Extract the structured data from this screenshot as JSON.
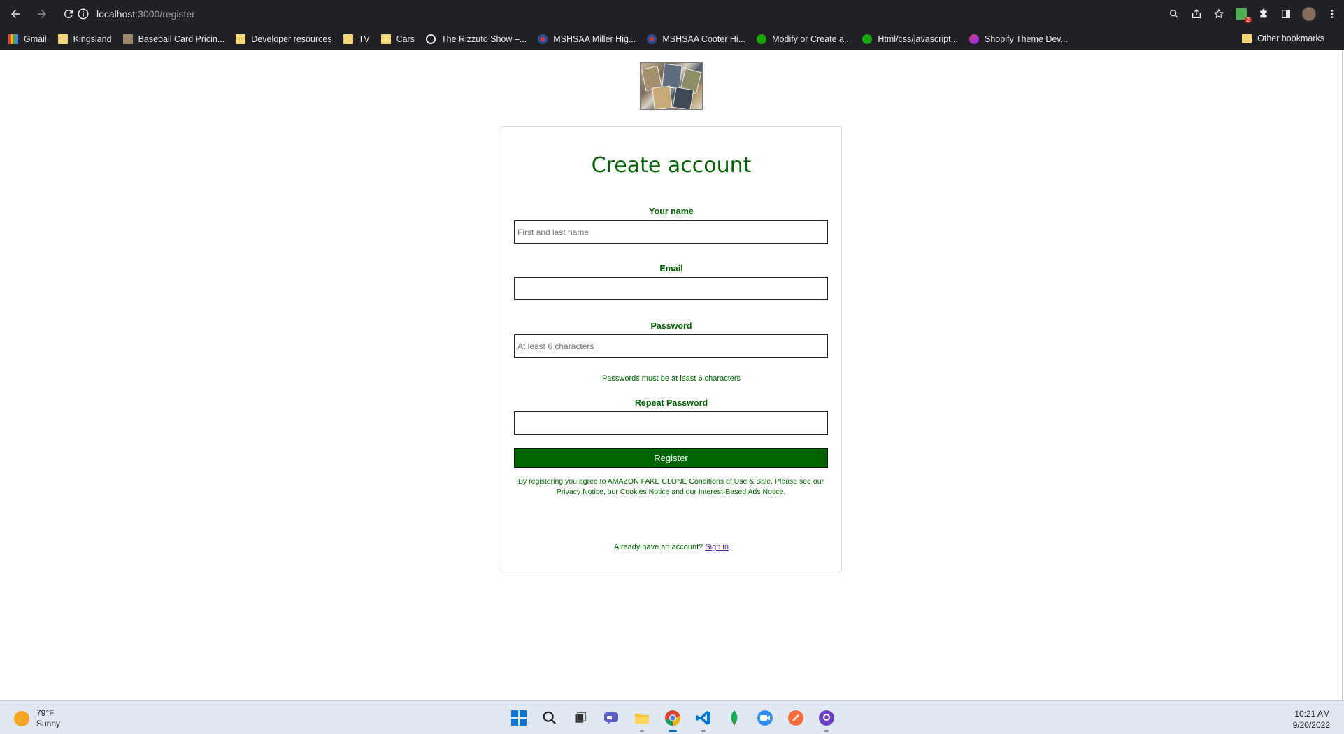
{
  "browser": {
    "url_host": "localhost",
    "url_path": ":3000/register",
    "bookmarks": [
      {
        "label": "Gmail",
        "icon": "gmail-icon"
      },
      {
        "label": "Kingsland",
        "icon": "folder-icon"
      },
      {
        "label": "Baseball Card Pricin...",
        "icon": "card-site-icon"
      },
      {
        "label": "Developer resources",
        "icon": "folder-icon"
      },
      {
        "label": "TV",
        "icon": "folder-icon"
      },
      {
        "label": "Cars",
        "icon": "folder-icon"
      },
      {
        "label": "The Rizzuto Show –...",
        "icon": "site-icon"
      },
      {
        "label": "MSHSAA Miller Hig...",
        "icon": "mshsaa-icon"
      },
      {
        "label": "MSHSAA Cooter Hi...",
        "icon": "mshsaa-icon"
      },
      {
        "label": "Modify or Create a...",
        "icon": "upwork-icon"
      },
      {
        "label": "Html/css/javascript...",
        "icon": "upwork-icon"
      },
      {
        "label": "Shopify Theme Dev...",
        "icon": "shopify-icon"
      }
    ],
    "other_bookmarks": "Other bookmarks",
    "extension_badge": "2"
  },
  "form": {
    "title": "Create account",
    "name_label": "Your name",
    "name_placeholder": "First and last name",
    "email_label": "Email",
    "email_value": "",
    "password_label": "Password",
    "password_placeholder": "At least 6 characters",
    "password_hint": "Passwords must be at least 6 characters",
    "repeat_label": "Repeat Password",
    "repeat_value": "",
    "register_button": "Register",
    "legal_text": "By registering you agree to AMAZON FAKE CLONE Conditions of Use & Sale. Please see our Privacy Notice, our Cookies Notice and our Interest-Based Ads Notice.",
    "signin_prompt": "Already have an account?",
    "signin_link": "Sign in"
  },
  "taskbar": {
    "temperature": "79°F",
    "condition": "Sunny",
    "time": "10:21 AM",
    "date": "9/20/2022"
  },
  "colors": {
    "accent": "#006400",
    "browser_chrome": "#202124",
    "taskbar": "#dfe8f3"
  }
}
